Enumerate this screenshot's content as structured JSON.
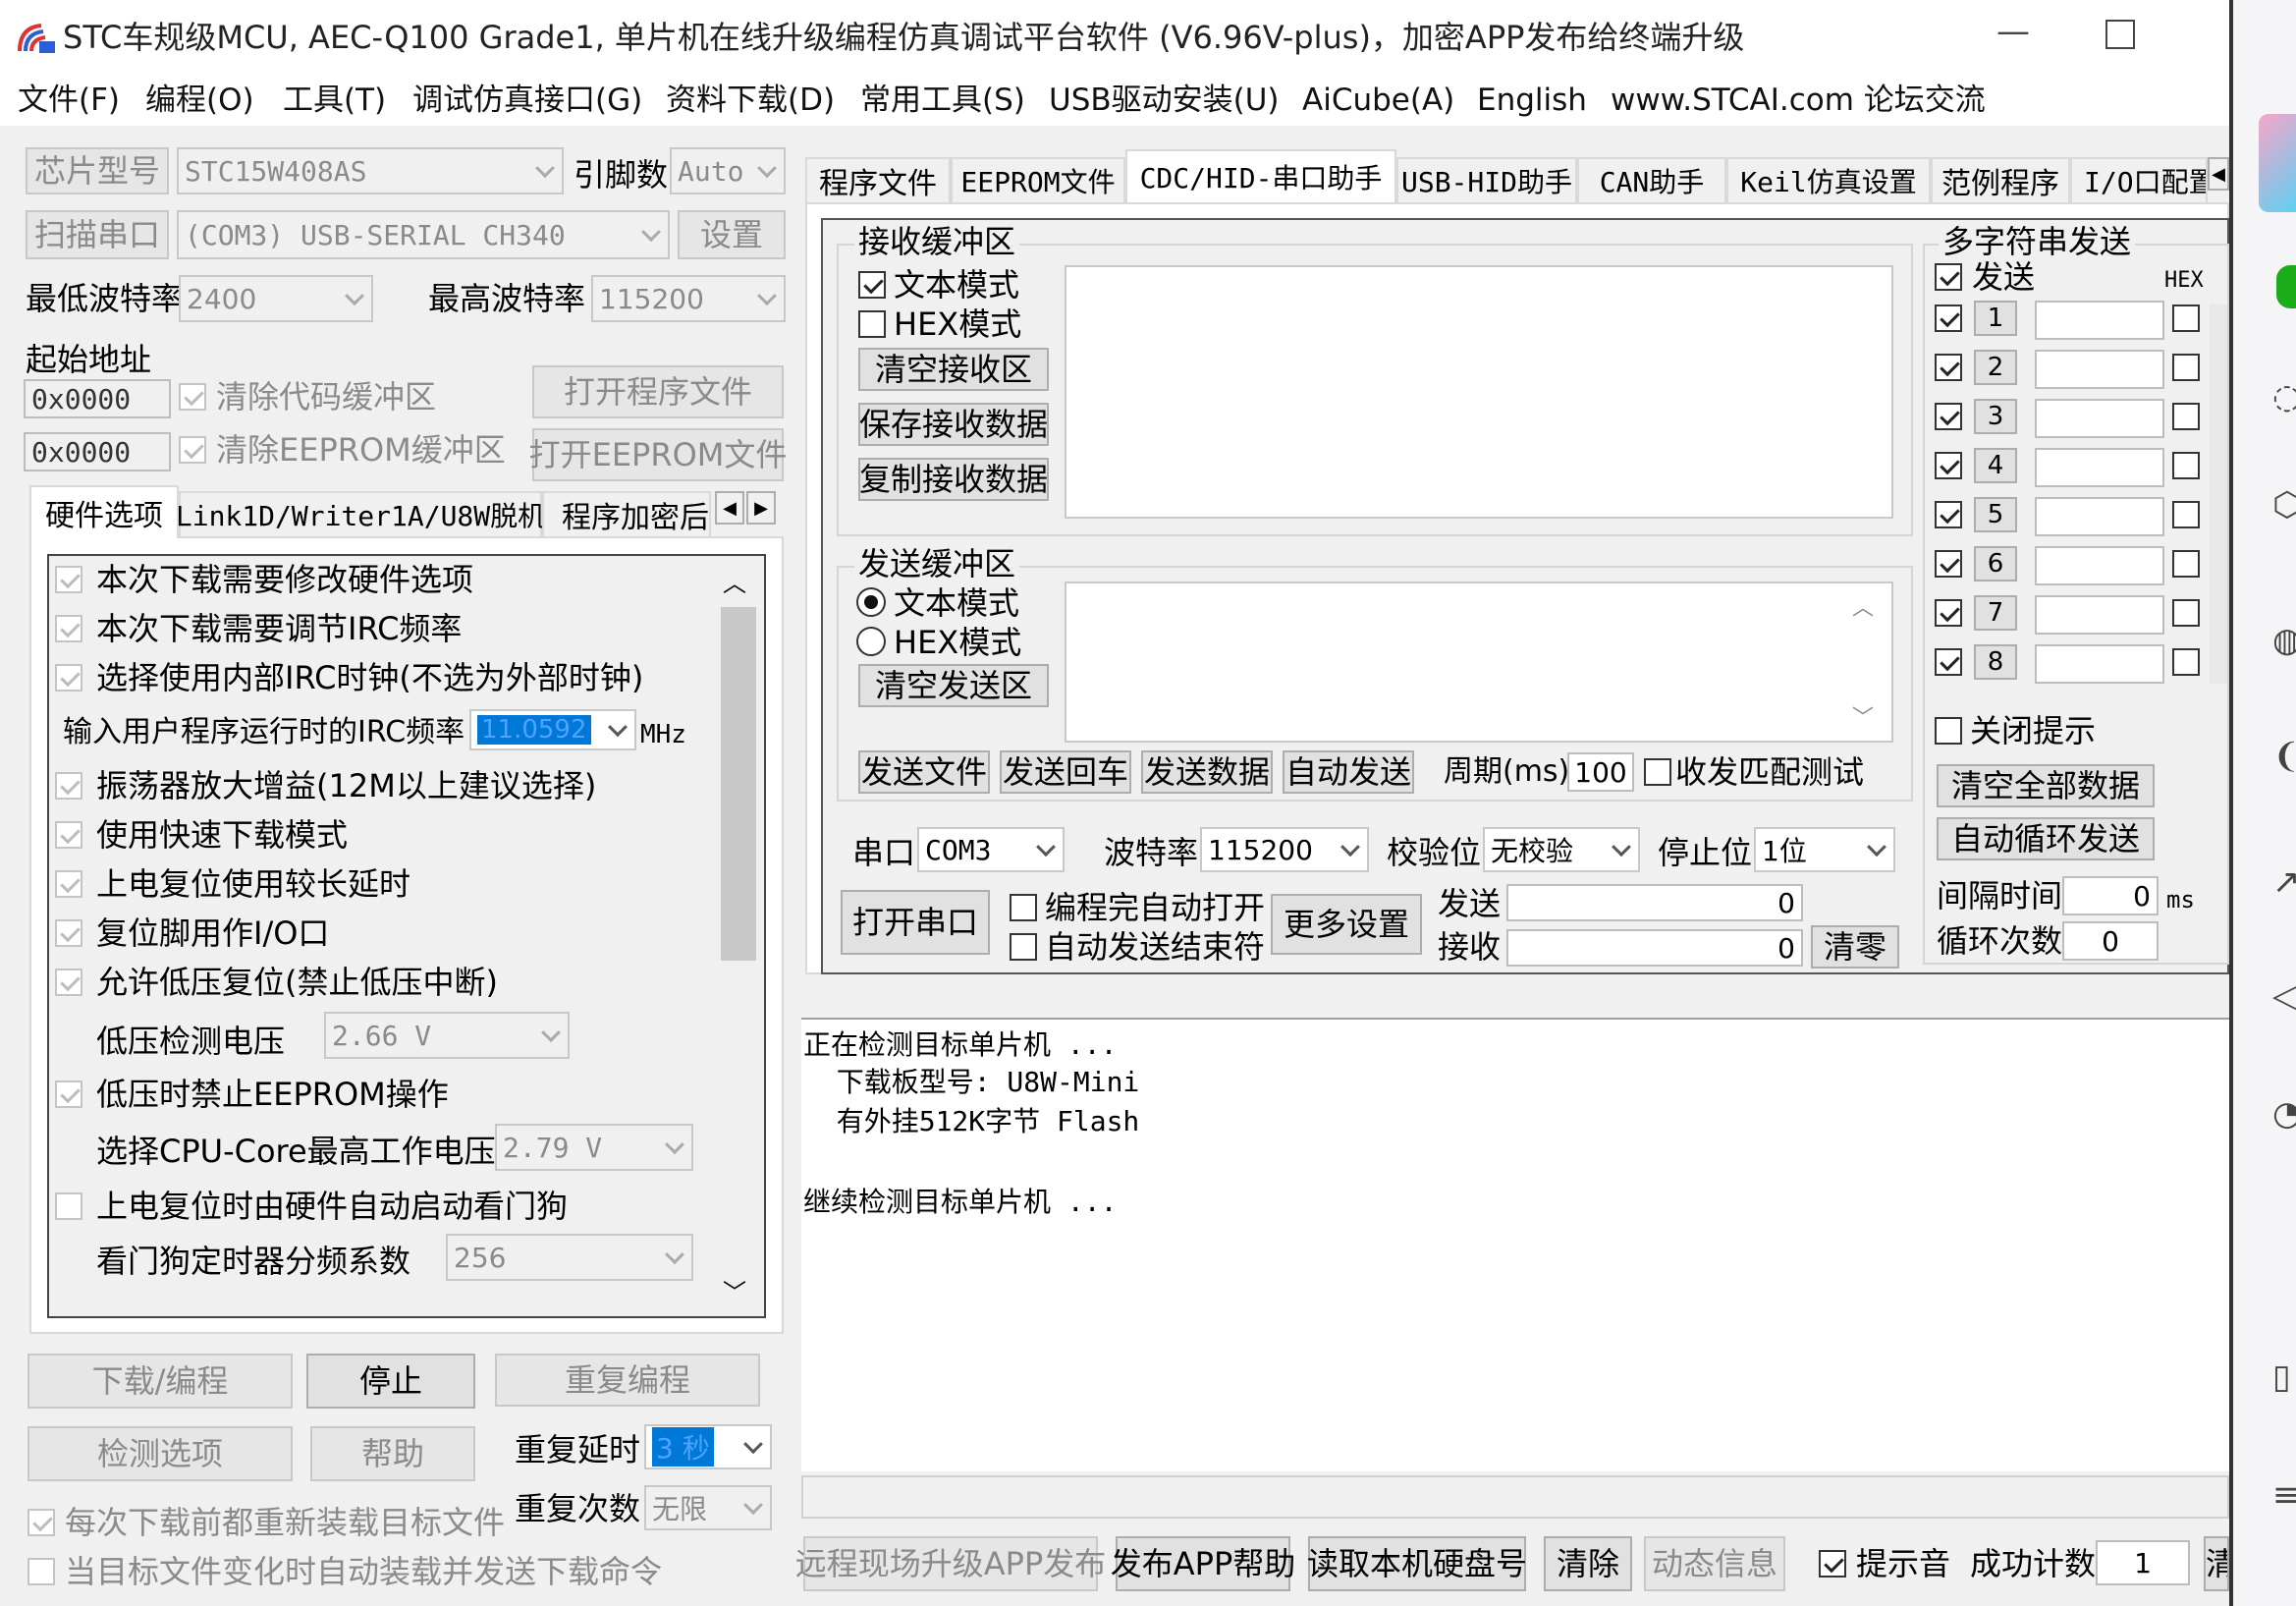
{
  "window": {
    "title": "STC车规级MCU, AEC-Q100 Grade1, 单片机在线升级编程仿真调试平台软件 (V6.96V-plus)，加密APP发布给终端升级",
    "minimize": "—"
  },
  "menu": [
    "文件(F)",
    "编程(O)",
    "工具(T)",
    "调试仿真接口(G)",
    "资料下载(D)",
    "常用工具(S)",
    "USB驱动安装(U)",
    "AiCube(A)",
    "English",
    "www.STCAI.com 论坛交流"
  ],
  "left": {
    "chip_label": "芯片型号",
    "chip_value": "STC15W408AS",
    "pin_label": "引脚数",
    "pin_value": "Auto",
    "scan_label": "扫描串口",
    "port_value": "(COM3) USB-SERIAL CH340",
    "settings_label": "设置",
    "min_baud_label": "最低波特率",
    "min_baud_value": "2400",
    "max_baud_label": "最高波特率",
    "max_baud_value": "115200",
    "start_addr_label": "起始地址",
    "addr1": "0x0000",
    "clear_code": "清除代码缓冲区",
    "open_prog": "打开程序文件",
    "addr2": "0x0000",
    "clear_eeprom": "清除EEPROM缓冲区",
    "open_eeprom": "打开EEPROM文件",
    "tabs": [
      "硬件选项",
      "Link1D/Writer1A/U8W脱机",
      "程序加密后"
    ],
    "options": {
      "opt1": "本次下载需要修改硬件选项",
      "opt2": "本次下载需要调节IRC频率",
      "opt3": "选择使用内部IRC时钟(不选为外部时钟)",
      "irc_label": "输入用户程序运行时的IRC频率",
      "irc_value": "11.0592",
      "irc_unit": "MHz",
      "opt4": "振荡器放大增益(12M以上建议选择)",
      "opt5": "使用快速下载模式",
      "opt6": "上电复位使用较长延时",
      "opt7": "复位脚用作I/O口",
      "opt8": "允许低压复位(禁止低压中断)",
      "lv_label": "低压检测电压",
      "lv_value": "2.66 V",
      "opt9": "低压时禁止EEPROM操作",
      "cpu_label": "选择CPU-Core最高工作电压",
      "cpu_value": "2.79 V",
      "opt10": "上电复位时由硬件自动启动看门狗",
      "wdt_label": "看门狗定时器分频系数",
      "wdt_value": "256"
    },
    "download": "下载/编程",
    "stop": "停止",
    "reprogram": "重复编程",
    "check_opts": "检测选项",
    "help": "帮助",
    "repeat_delay_label": "重复延时",
    "repeat_delay_value": "3 秒",
    "repeat_count_label": "重复次数",
    "repeat_count_value": "无限",
    "reload_each": "每次下载前都重新装载目标文件",
    "auto_reload": "当目标文件变化时自动装载并发送下载命令"
  },
  "right_tabs": [
    "程序文件",
    "EEPROM文件",
    "CDC/HID-串口助手",
    "USB-HID助手",
    "CAN助手",
    "Keil仿真设置",
    "范例程序",
    "I/O口配置"
  ],
  "serial": {
    "recv_group": "接收缓冲区",
    "text_mode": "文本模式",
    "hex_mode": "HEX模式",
    "clear_recv": "清空接收区",
    "save_recv": "保存接收数据",
    "copy_recv": "复制接收数据",
    "send_group": "发送缓冲区",
    "clear_send": "清空发送区",
    "send_file": "发送文件",
    "send_enter": "发送回车",
    "send_data": "发送数据",
    "auto_send": "自动发送",
    "period_label": "周期(ms)",
    "period_value": "100",
    "match_test": "收发匹配测试",
    "port_label": "串口",
    "port_value": "COM3",
    "baud_label": "波特率",
    "baud_value": "115200",
    "parity_label": "校验位",
    "parity_value": "无校验",
    "stop_label": "停止位",
    "stop_value": "1位",
    "open_port": "打开串口",
    "auto_open": "编程完自动打开",
    "auto_end": "自动发送结束符",
    "more_settings": "更多设置",
    "send_label": "发送",
    "send_count": "0",
    "recv_label": "接收",
    "recv_count": "0",
    "clear_counts": "清零"
  },
  "multi": {
    "title": "多字符串发送",
    "send": "发送",
    "hex": "HEX",
    "rows": [
      "1",
      "2",
      "3",
      "4",
      "5",
      "6",
      "7",
      "8"
    ],
    "close_tip": "关闭提示",
    "clear_all": "清空全部数据",
    "auto_loop": "自动循环发送",
    "interval_label": "间隔时间",
    "interval_value": "0",
    "interval_unit": "ms",
    "loop_label": "循环次数",
    "loop_value": "0"
  },
  "log": {
    "line1": "正在检测目标单片机 ...",
    "line2": "  下载板型号: U8W-Mini",
    "line3": "  有外挂512K字节 Flash",
    "line4": "继续检测目标单片机 ..."
  },
  "bottom": {
    "remote_app": "远程现场升级APP发布",
    "app_help": "发布APP帮助",
    "read_disk": "读取本机硬盘号",
    "clear": "清除",
    "dynamic": "动态信息",
    "beep": "提示音",
    "success_label": "成功计数",
    "success_value": "1",
    "cut_btn": "清"
  }
}
